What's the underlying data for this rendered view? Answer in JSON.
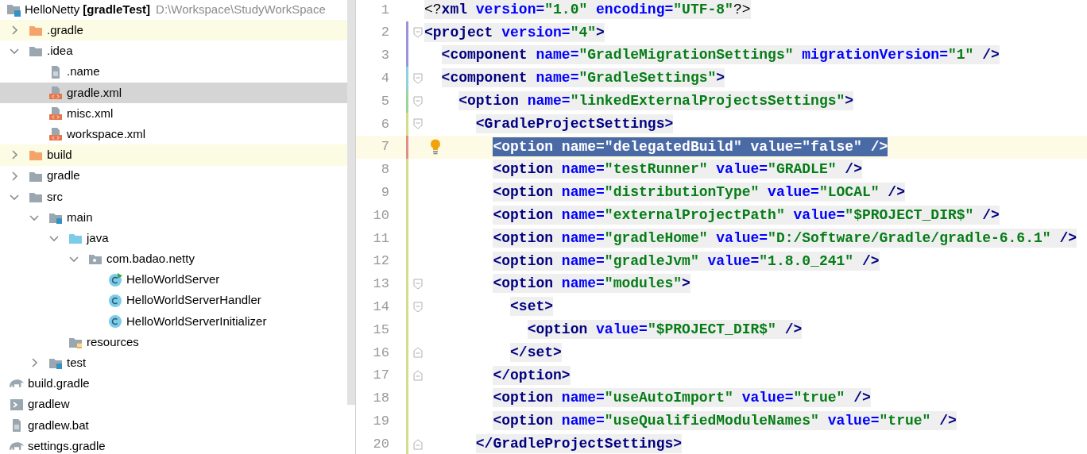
{
  "project_tree": {
    "root": {
      "label": "HelloNetty **[gradleTest]**",
      "path": "D:\\Workspace\\StudyWorkSpace",
      "selected": false
    },
    "items": [
      {
        "label": ".gradle",
        "kind": "folder",
        "expanded": false,
        "excluded": true,
        "selected": false
      },
      {
        "label": ".idea",
        "kind": "folder",
        "expanded": true,
        "excluded": false,
        "selected": false,
        "children": [
          {
            "label": ".name",
            "kind": "text-file",
            "excluded": false,
            "selected": false
          },
          {
            "label": "gradle.xml",
            "kind": "xml-file",
            "excluded": false,
            "selected": true
          },
          {
            "label": "misc.xml",
            "kind": "xml-file",
            "excluded": false,
            "selected": false
          },
          {
            "label": "workspace.xml",
            "kind": "xml-file",
            "excluded": false,
            "selected": false
          }
        ]
      },
      {
        "label": "build",
        "kind": "folder",
        "expanded": false,
        "excluded": true,
        "selected": false
      },
      {
        "label": "gradle",
        "kind": "folder",
        "expanded": false,
        "excluded": false,
        "selected": false
      },
      {
        "label": "src",
        "kind": "folder",
        "expanded": true,
        "excluded": false,
        "selected": false,
        "children": [
          {
            "label": "main",
            "kind": "module-folder",
            "expanded": true,
            "excluded": false,
            "selected": false,
            "children": [
              {
                "label": "java",
                "kind": "source-folder",
                "expanded": true,
                "excluded": false,
                "selected": false,
                "children": [
                  {
                    "label": "com.badao.netty",
                    "kind": "package",
                    "expanded": true,
                    "excluded": false,
                    "selected": false,
                    "children": [
                      {
                        "label": "HelloWorldServer",
                        "kind": "main-class",
                        "excluded": false,
                        "selected": false
                      },
                      {
                        "label": "HelloWorldServerHandler",
                        "kind": "class",
                        "excluded": false,
                        "selected": false
                      },
                      {
                        "label": "HelloWorldServerInitializer",
                        "kind": "class",
                        "excluded": false,
                        "selected": false
                      }
                    ]
                  }
                ]
              },
              {
                "label": "resources",
                "kind": "resources-folder",
                "excluded": false,
                "selected": false
              }
            ]
          },
          {
            "label": "test",
            "kind": "module-folder",
            "expanded": false,
            "excluded": false,
            "selected": false
          }
        ]
      },
      {
        "label": "build.gradle",
        "kind": "gradle-file",
        "excluded": false,
        "selected": false
      },
      {
        "label": "gradlew",
        "kind": "script-file",
        "excluded": false,
        "selected": false
      },
      {
        "label": "gradlew.bat",
        "kind": "text-file",
        "excluded": false,
        "selected": false
      },
      {
        "label": "settings.gradle",
        "kind": "gradle-file",
        "excluded": false,
        "selected": false
      }
    ]
  },
  "editor": {
    "lines": [
      {
        "number": "1",
        "current": false,
        "selected": false,
        "intention_bulb": false,
        "fold_start": false,
        "fold_end": false,
        "tokens": [
          {
            "kind": "punct",
            "text": "<?"
          },
          {
            "kind": "tag",
            "text": "xml"
          },
          {
            "kind": "attr",
            "text": " version="
          },
          {
            "kind": "value",
            "text": "\"1.0\""
          },
          {
            "kind": "attr",
            "text": " encoding="
          },
          {
            "kind": "value",
            "text": "\"UTF-8\""
          },
          {
            "kind": "punct",
            "text": "?>"
          }
        ]
      },
      {
        "number": "2",
        "current": false,
        "selected": false,
        "intention_bulb": false,
        "color": "#9b94d8",
        "fold_start": true,
        "fold_end": false,
        "tokens": [
          {
            "kind": "tag",
            "text": "<project"
          },
          {
            "kind": "attr",
            "text": " version="
          },
          {
            "kind": "value",
            "text": "\"4\""
          },
          {
            "kind": "tag",
            "text": ">"
          }
        ]
      },
      {
        "number": "3",
        "current": false,
        "selected": false,
        "intention_bulb": false,
        "color": "#9b94d8",
        "fold_start": false,
        "fold_end": false,
        "tokens": [
          {
            "kind": "tag",
            "text": "  <component"
          },
          {
            "kind": "attr",
            "text": " name="
          },
          {
            "kind": "value",
            "text": "\"GradleMigrationSettings\""
          },
          {
            "kind": "attr",
            "text": " migrationVersion="
          },
          {
            "kind": "value",
            "text": "\"1\""
          },
          {
            "kind": "tag",
            "text": " />"
          }
        ]
      },
      {
        "number": "4",
        "current": false,
        "selected": false,
        "intention_bulb": false,
        "color": "#8fd1dc",
        "fold_start": true,
        "fold_end": false,
        "tokens": [
          {
            "kind": "tag",
            "text": "  <component"
          },
          {
            "kind": "attr",
            "text": " name="
          },
          {
            "kind": "value",
            "text": "\"GradleSettings\""
          },
          {
            "kind": "tag",
            "text": ">"
          }
        ]
      },
      {
        "number": "5",
        "current": false,
        "selected": false,
        "intention_bulb": false,
        "color": "#9ed39e",
        "fold_start": true,
        "fold_end": false,
        "tokens": [
          {
            "kind": "tag",
            "text": "    <option"
          },
          {
            "kind": "attr",
            "text": " name="
          },
          {
            "kind": "value",
            "text": "\"linkedExternalProjectsSettings\""
          },
          {
            "kind": "tag",
            "text": ">"
          }
        ]
      },
      {
        "number": "6",
        "current": false,
        "selected": false,
        "intention_bulb": false,
        "color": "#d5dd8c",
        "fold_start": true,
        "fold_end": false,
        "tokens": [
          {
            "kind": "tag",
            "text": "      <GradleProjectSettings"
          },
          {
            "kind": "tag",
            "text": ">"
          }
        ]
      },
      {
        "number": "7",
        "current": true,
        "selected": true,
        "intention_bulb": true,
        "color": "#e38c8c",
        "fold_start": false,
        "fold_end": false,
        "tokens": [
          {
            "kind": "tag",
            "text": "        <option"
          },
          {
            "kind": "attr",
            "text": " name="
          },
          {
            "kind": "value",
            "text": "\"delegatedBuild\""
          },
          {
            "kind": "attr",
            "text": " value="
          },
          {
            "kind": "value",
            "text": "\"false\""
          },
          {
            "kind": "tag",
            "text": " />"
          }
        ]
      },
      {
        "number": "8",
        "current": false,
        "selected": false,
        "intention_bulb": false,
        "color": "#d5dd8c",
        "fold_start": false,
        "fold_end": false,
        "tokens": [
          {
            "kind": "tag",
            "text": "        <option"
          },
          {
            "kind": "attr",
            "text": " name="
          },
          {
            "kind": "value",
            "text": "\"testRunner\""
          },
          {
            "kind": "attr",
            "text": " value="
          },
          {
            "kind": "value",
            "text": "\"GRADLE\""
          },
          {
            "kind": "tag",
            "text": " />"
          }
        ]
      },
      {
        "number": "9",
        "current": false,
        "selected": false,
        "intention_bulb": false,
        "color": "#d5dd8c",
        "fold_start": false,
        "fold_end": false,
        "tokens": [
          {
            "kind": "tag",
            "text": "        <option"
          },
          {
            "kind": "attr",
            "text": " name="
          },
          {
            "kind": "value",
            "text": "\"distributionType\""
          },
          {
            "kind": "attr",
            "text": " value="
          },
          {
            "kind": "value",
            "text": "\"LOCAL\""
          },
          {
            "kind": "tag",
            "text": " />"
          }
        ]
      },
      {
        "number": "10",
        "current": false,
        "selected": false,
        "intention_bulb": false,
        "color": "#d5dd8c",
        "fold_start": false,
        "fold_end": false,
        "tokens": [
          {
            "kind": "tag",
            "text": "        <option"
          },
          {
            "kind": "attr",
            "text": " name="
          },
          {
            "kind": "value",
            "text": "\"externalProjectPath\""
          },
          {
            "kind": "attr",
            "text": " value="
          },
          {
            "kind": "value",
            "text": "\"$PROJECT_DIR$\""
          },
          {
            "kind": "tag",
            "text": " />"
          }
        ]
      },
      {
        "number": "11",
        "current": false,
        "selected": false,
        "intention_bulb": false,
        "color": "#d5dd8c",
        "fold_start": false,
        "fold_end": false,
        "tokens": [
          {
            "kind": "tag",
            "text": "        <option"
          },
          {
            "kind": "attr",
            "text": " name="
          },
          {
            "kind": "value",
            "text": "\"gradleHome\""
          },
          {
            "kind": "attr",
            "text": " value="
          },
          {
            "kind": "value",
            "text": "\"D:/Software/Gradle/gradle-6.6.1\""
          },
          {
            "kind": "tag",
            "text": " />"
          }
        ]
      },
      {
        "number": "12",
        "current": false,
        "selected": false,
        "intention_bulb": false,
        "color": "#d5dd8c",
        "fold_start": false,
        "fold_end": false,
        "tokens": [
          {
            "kind": "tag",
            "text": "        <option"
          },
          {
            "kind": "attr",
            "text": " name="
          },
          {
            "kind": "value",
            "text": "\"gradleJvm\""
          },
          {
            "kind": "attr",
            "text": " value="
          },
          {
            "kind": "value",
            "text": "\"1.8.0_241\""
          },
          {
            "kind": "tag",
            "text": " />"
          }
        ]
      },
      {
        "number": "13",
        "current": false,
        "selected": false,
        "intention_bulb": false,
        "color": "#d5dd8c",
        "fold_start": true,
        "fold_end": false,
        "tokens": [
          {
            "kind": "tag",
            "text": "        <option"
          },
          {
            "kind": "attr",
            "text": " name="
          },
          {
            "kind": "value",
            "text": "\"modules\""
          },
          {
            "kind": "tag",
            "text": ">"
          }
        ]
      },
      {
        "number": "14",
        "current": false,
        "selected": false,
        "intention_bulb": false,
        "color": "#d5dd8c",
        "fold_start": true,
        "fold_end": false,
        "tokens": [
          {
            "kind": "tag",
            "text": "          <set"
          },
          {
            "kind": "tag",
            "text": ">"
          }
        ]
      },
      {
        "number": "15",
        "current": false,
        "selected": false,
        "intention_bulb": false,
        "color": "#d5dd8c",
        "fold_start": false,
        "fold_end": false,
        "tokens": [
          {
            "kind": "tag",
            "text": "            <option"
          },
          {
            "kind": "attr",
            "text": " value="
          },
          {
            "kind": "value",
            "text": "\"$PROJECT_DIR$\""
          },
          {
            "kind": "tag",
            "text": " />"
          }
        ]
      },
      {
        "number": "16",
        "current": false,
        "selected": false,
        "intention_bulb": false,
        "color": "#d5dd8c",
        "fold_start": false,
        "fold_end": true,
        "tokens": [
          {
            "kind": "tag",
            "text": "          </set"
          },
          {
            "kind": "tag",
            "text": ">"
          }
        ]
      },
      {
        "number": "17",
        "current": false,
        "selected": false,
        "intention_bulb": false,
        "color": "#d5dd8c",
        "fold_start": false,
        "fold_end": true,
        "tokens": [
          {
            "kind": "tag",
            "text": "        </option"
          },
          {
            "kind": "tag",
            "text": ">"
          }
        ]
      },
      {
        "number": "18",
        "current": false,
        "selected": false,
        "intention_bulb": false,
        "color": "#d5dd8c",
        "fold_start": false,
        "fold_end": false,
        "tokens": [
          {
            "kind": "tag",
            "text": "        <option"
          },
          {
            "kind": "attr",
            "text": " name="
          },
          {
            "kind": "value",
            "text": "\"useAutoImport\""
          },
          {
            "kind": "attr",
            "text": " value="
          },
          {
            "kind": "value",
            "text": "\"true\""
          },
          {
            "kind": "tag",
            "text": " />"
          }
        ]
      },
      {
        "number": "19",
        "current": false,
        "selected": false,
        "intention_bulb": false,
        "color": "#d5dd8c",
        "fold_start": false,
        "fold_end": false,
        "tokens": [
          {
            "kind": "tag",
            "text": "        <option"
          },
          {
            "kind": "attr",
            "text": " name="
          },
          {
            "kind": "value",
            "text": "\"useQualifiedModuleNames\""
          },
          {
            "kind": "attr",
            "text": " value="
          },
          {
            "kind": "value",
            "text": "\"true\""
          },
          {
            "kind": "tag",
            "text": " />"
          }
        ]
      },
      {
        "number": "20",
        "current": false,
        "selected": false,
        "intention_bulb": false,
        "color": "#d5dd8c",
        "fold_start": false,
        "fold_end": true,
        "tokens": [
          {
            "kind": "tag",
            "text": "      </GradleProjectSettings"
          },
          {
            "kind": "tag",
            "text": ">"
          }
        ]
      }
    ]
  }
}
